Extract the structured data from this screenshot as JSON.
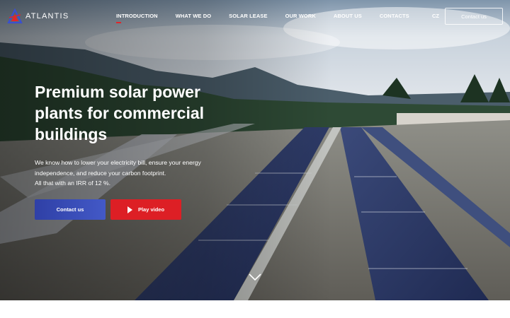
{
  "brand": {
    "name": "ATLANTIS",
    "accent": "#e0262b",
    "blue": "#3548b4"
  },
  "nav": {
    "items": [
      {
        "label": "INTRODUCTION",
        "active": true
      },
      {
        "label": "WHAT WE DO"
      },
      {
        "label": "SOLAR LEASE"
      },
      {
        "label": "OUR WORK"
      },
      {
        "label": "ABOUT US"
      },
      {
        "label": "CONTACTS"
      }
    ],
    "language": "CZ",
    "contact_button": "Contact us"
  },
  "hero": {
    "headline": [
      "Premium solar power",
      "plants for commercial",
      "buildings"
    ],
    "description": [
      "We know how to lower your electricity bill, ensure your energy",
      "independence, and reduce your carbon footprint.",
      "All that with an IRR of 12 %."
    ],
    "primary_button": "Contact us",
    "secondary_button": "Play video",
    "icons": {
      "logo": "atlantis-logo",
      "play": "play-icon",
      "scroll": "chevron-down-icon"
    }
  }
}
